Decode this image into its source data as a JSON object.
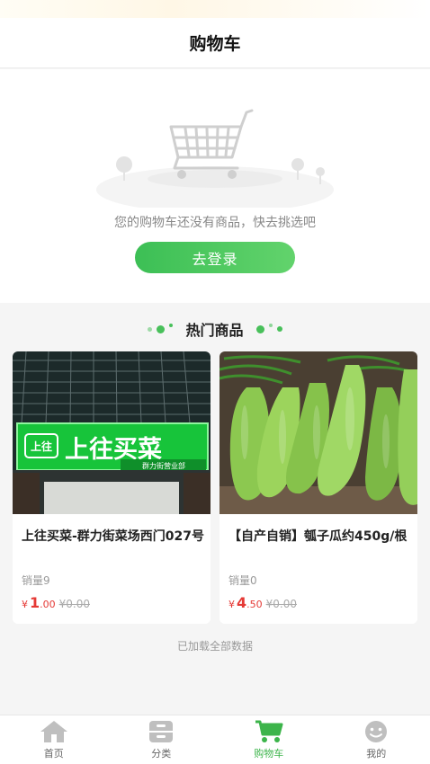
{
  "header": {
    "title": "购物车"
  },
  "empty_cart": {
    "message": "您的购物车还没有商品，快去挑选吧",
    "login_label": "去登录"
  },
  "hot": {
    "title": "热门商品"
  },
  "products": [
    {
      "name": "上往买菜-群力街菜场西门027号",
      "sales_label": "销量",
      "sales": "9",
      "currency": "¥",
      "price_int": "1",
      "price_dec": ".00",
      "original_price": "¥0.00",
      "sign_text": "上往买菜",
      "sign_logo": "上往",
      "sign_sub": "群力街营业部"
    },
    {
      "name": "【自产自销】瓠子瓜约450g/根",
      "sales_label": "销量",
      "sales": "0",
      "currency": "¥",
      "price_int": "4",
      "price_dec": ".50",
      "original_price": "¥0.00"
    }
  ],
  "footer_text": "已加载全部数据",
  "tabs": [
    {
      "label": "首页",
      "icon": "home-icon"
    },
    {
      "label": "分类",
      "icon": "category-icon"
    },
    {
      "label": "购物车",
      "icon": "cart-icon",
      "active": true
    },
    {
      "label": "我的",
      "icon": "profile-icon"
    }
  ],
  "colors": {
    "accent": "#3cb44a",
    "price": "#e53935"
  }
}
